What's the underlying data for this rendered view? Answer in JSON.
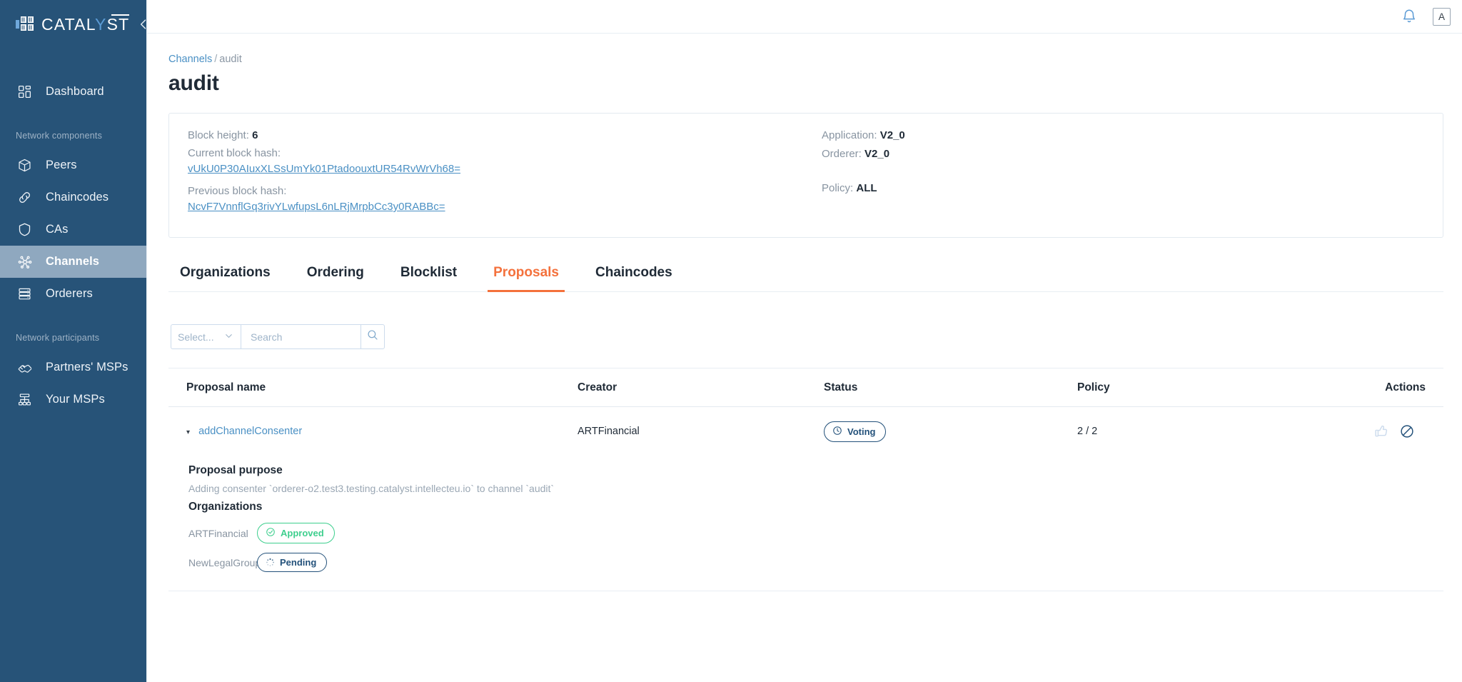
{
  "brand": {
    "name_first": "CATAL",
    "name_hl": "Y",
    "name_last": "ST",
    "collapse_icon": "chevron-left-icon"
  },
  "sidebar": {
    "items": [
      {
        "label": "Dashboard",
        "icon": "grid-icon",
        "active": false
      }
    ],
    "group_components_label": "Network components",
    "components": [
      {
        "label": "Peers",
        "icon": "cube-icon",
        "active": false
      },
      {
        "label": "Chaincodes",
        "icon": "link-icon",
        "active": false
      },
      {
        "label": "CAs",
        "icon": "shield-icon",
        "active": false
      },
      {
        "label": "Channels",
        "icon": "network-nodes-icon",
        "active": true
      },
      {
        "label": "Orderers",
        "icon": "server-stack-icon",
        "active": false
      }
    ],
    "group_participants_label": "Network participants",
    "participants": [
      {
        "label": "Partners' MSPs",
        "icon": "handshake-icon",
        "active": false
      },
      {
        "label": "Your MSPs",
        "icon": "org-chart-icon",
        "active": false
      }
    ]
  },
  "topbar": {
    "notifications_icon": "bell-icon",
    "avatar_initial": "A"
  },
  "breadcrumb": {
    "root": "Channels",
    "separator": "/",
    "current": "audit"
  },
  "page": {
    "title": "audit"
  },
  "channel_info": {
    "block_height_label": "Block height:",
    "block_height_value": "6",
    "current_hash_label": "Current block hash:",
    "current_hash_value": "vUkU0P30AIuxXLSsUmYk01PtadoouxtUR54RvWrVh68=",
    "previous_hash_label": "Previous block hash:",
    "previous_hash_value": "NcvF7VnnflGq3rivYLwfupsL6nLRjMrpbCc3y0RABBc=",
    "application_label": "Application:",
    "application_value": "V2_0",
    "orderer_label": "Orderer:",
    "orderer_value": "V2_0",
    "policy_label": "Policy:",
    "policy_value": "ALL"
  },
  "tabs": [
    {
      "label": "Organizations",
      "active": false
    },
    {
      "label": "Ordering",
      "active": false
    },
    {
      "label": "Blocklist",
      "active": false
    },
    {
      "label": "Proposals",
      "active": true
    },
    {
      "label": "Chaincodes",
      "active": false
    }
  ],
  "filters": {
    "select_placeholder": "Select...",
    "select_chevron_icon": "chevron-down-icon",
    "search_placeholder": "Search",
    "search_value": "",
    "search_button_icon": "search-icon"
  },
  "table": {
    "columns": {
      "name": "Proposal name",
      "creator": "Creator",
      "status": "Status",
      "policy": "Policy",
      "actions": "Actions"
    },
    "row": {
      "caret_icon": "caret-down-icon",
      "name": "addChannelConsenter",
      "creator": "ARTFinancial",
      "status_label": "Voting",
      "status_icon": "clock-icon",
      "policy": "2 / 2",
      "approve_icon": "thumbs-up-icon",
      "reject_icon": "ban-icon"
    }
  },
  "detail": {
    "purpose_heading": "Proposal purpose",
    "purpose_text": "Adding consenter `orderer-o2.test3.testing.catalyst.intellecteu.io` to channel `audit`",
    "organizations_heading": "Organizations",
    "organizations": [
      {
        "name": "ARTFinancial",
        "status": "Approved",
        "status_icon": "check-circle-icon",
        "color": "#3ecf8e"
      },
      {
        "name": "NewLegalGroup",
        "status": "Pending",
        "status_icon": "spinner-icon",
        "color": "#23517a"
      }
    ]
  },
  "colors": {
    "sidebar_bg": "#275378",
    "sidebar_active": "#8fa8bf",
    "accent_orange": "#f4713c",
    "link_blue": "#4a90c4",
    "navy": "#23517a",
    "green": "#3ecf8e"
  }
}
